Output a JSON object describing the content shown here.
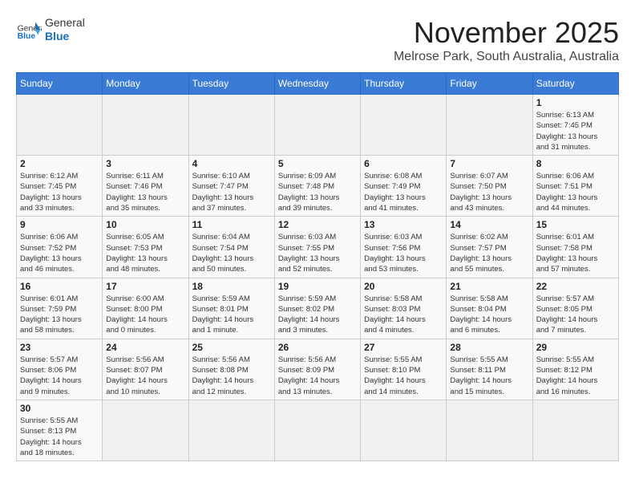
{
  "header": {
    "logo_general": "General",
    "logo_blue": "Blue",
    "month": "November 2025",
    "location": "Melrose Park, South Australia, Australia"
  },
  "days_of_week": [
    "Sunday",
    "Monday",
    "Tuesday",
    "Wednesday",
    "Thursday",
    "Friday",
    "Saturday"
  ],
  "weeks": [
    [
      {
        "day": "",
        "info": ""
      },
      {
        "day": "",
        "info": ""
      },
      {
        "day": "",
        "info": ""
      },
      {
        "day": "",
        "info": ""
      },
      {
        "day": "",
        "info": ""
      },
      {
        "day": "",
        "info": ""
      },
      {
        "day": "1",
        "info": "Sunrise: 6:13 AM\nSunset: 7:45 PM\nDaylight: 13 hours\nand 31 minutes."
      }
    ],
    [
      {
        "day": "2",
        "info": "Sunrise: 6:12 AM\nSunset: 7:45 PM\nDaylight: 13 hours\nand 33 minutes."
      },
      {
        "day": "3",
        "info": "Sunrise: 6:11 AM\nSunset: 7:46 PM\nDaylight: 13 hours\nand 35 minutes."
      },
      {
        "day": "4",
        "info": "Sunrise: 6:10 AM\nSunset: 7:47 PM\nDaylight: 13 hours\nand 37 minutes."
      },
      {
        "day": "5",
        "info": "Sunrise: 6:09 AM\nSunset: 7:48 PM\nDaylight: 13 hours\nand 39 minutes."
      },
      {
        "day": "6",
        "info": "Sunrise: 6:08 AM\nSunset: 7:49 PM\nDaylight: 13 hours\nand 41 minutes."
      },
      {
        "day": "7",
        "info": "Sunrise: 6:07 AM\nSunset: 7:50 PM\nDaylight: 13 hours\nand 43 minutes."
      },
      {
        "day": "8",
        "info": "Sunrise: 6:06 AM\nSunset: 7:51 PM\nDaylight: 13 hours\nand 44 minutes."
      }
    ],
    [
      {
        "day": "9",
        "info": "Sunrise: 6:06 AM\nSunset: 7:52 PM\nDaylight: 13 hours\nand 46 minutes."
      },
      {
        "day": "10",
        "info": "Sunrise: 6:05 AM\nSunset: 7:53 PM\nDaylight: 13 hours\nand 48 minutes."
      },
      {
        "day": "11",
        "info": "Sunrise: 6:04 AM\nSunset: 7:54 PM\nDaylight: 13 hours\nand 50 minutes."
      },
      {
        "day": "12",
        "info": "Sunrise: 6:03 AM\nSunset: 7:55 PM\nDaylight: 13 hours\nand 52 minutes."
      },
      {
        "day": "13",
        "info": "Sunrise: 6:03 AM\nSunset: 7:56 PM\nDaylight: 13 hours\nand 53 minutes."
      },
      {
        "day": "14",
        "info": "Sunrise: 6:02 AM\nSunset: 7:57 PM\nDaylight: 13 hours\nand 55 minutes."
      },
      {
        "day": "15",
        "info": "Sunrise: 6:01 AM\nSunset: 7:58 PM\nDaylight: 13 hours\nand 57 minutes."
      }
    ],
    [
      {
        "day": "16",
        "info": "Sunrise: 6:01 AM\nSunset: 7:59 PM\nDaylight: 13 hours\nand 58 minutes."
      },
      {
        "day": "17",
        "info": "Sunrise: 6:00 AM\nSunset: 8:00 PM\nDaylight: 14 hours\nand 0 minutes."
      },
      {
        "day": "18",
        "info": "Sunrise: 5:59 AM\nSunset: 8:01 PM\nDaylight: 14 hours\nand 1 minute."
      },
      {
        "day": "19",
        "info": "Sunrise: 5:59 AM\nSunset: 8:02 PM\nDaylight: 14 hours\nand 3 minutes."
      },
      {
        "day": "20",
        "info": "Sunrise: 5:58 AM\nSunset: 8:03 PM\nDaylight: 14 hours\nand 4 minutes."
      },
      {
        "day": "21",
        "info": "Sunrise: 5:58 AM\nSunset: 8:04 PM\nDaylight: 14 hours\nand 6 minutes."
      },
      {
        "day": "22",
        "info": "Sunrise: 5:57 AM\nSunset: 8:05 PM\nDaylight: 14 hours\nand 7 minutes."
      }
    ],
    [
      {
        "day": "23",
        "info": "Sunrise: 5:57 AM\nSunset: 8:06 PM\nDaylight: 14 hours\nand 9 minutes."
      },
      {
        "day": "24",
        "info": "Sunrise: 5:56 AM\nSunset: 8:07 PM\nDaylight: 14 hours\nand 10 minutes."
      },
      {
        "day": "25",
        "info": "Sunrise: 5:56 AM\nSunset: 8:08 PM\nDaylight: 14 hours\nand 12 minutes."
      },
      {
        "day": "26",
        "info": "Sunrise: 5:56 AM\nSunset: 8:09 PM\nDaylight: 14 hours\nand 13 minutes."
      },
      {
        "day": "27",
        "info": "Sunrise: 5:55 AM\nSunset: 8:10 PM\nDaylight: 14 hours\nand 14 minutes."
      },
      {
        "day": "28",
        "info": "Sunrise: 5:55 AM\nSunset: 8:11 PM\nDaylight: 14 hours\nand 15 minutes."
      },
      {
        "day": "29",
        "info": "Sunrise: 5:55 AM\nSunset: 8:12 PM\nDaylight: 14 hours\nand 16 minutes."
      }
    ],
    [
      {
        "day": "30",
        "info": "Sunrise: 5:55 AM\nSunset: 8:13 PM\nDaylight: 14 hours\nand 18 minutes."
      },
      {
        "day": "",
        "info": ""
      },
      {
        "day": "",
        "info": ""
      },
      {
        "day": "",
        "info": ""
      },
      {
        "day": "",
        "info": ""
      },
      {
        "day": "",
        "info": ""
      },
      {
        "day": "",
        "info": ""
      }
    ]
  ]
}
